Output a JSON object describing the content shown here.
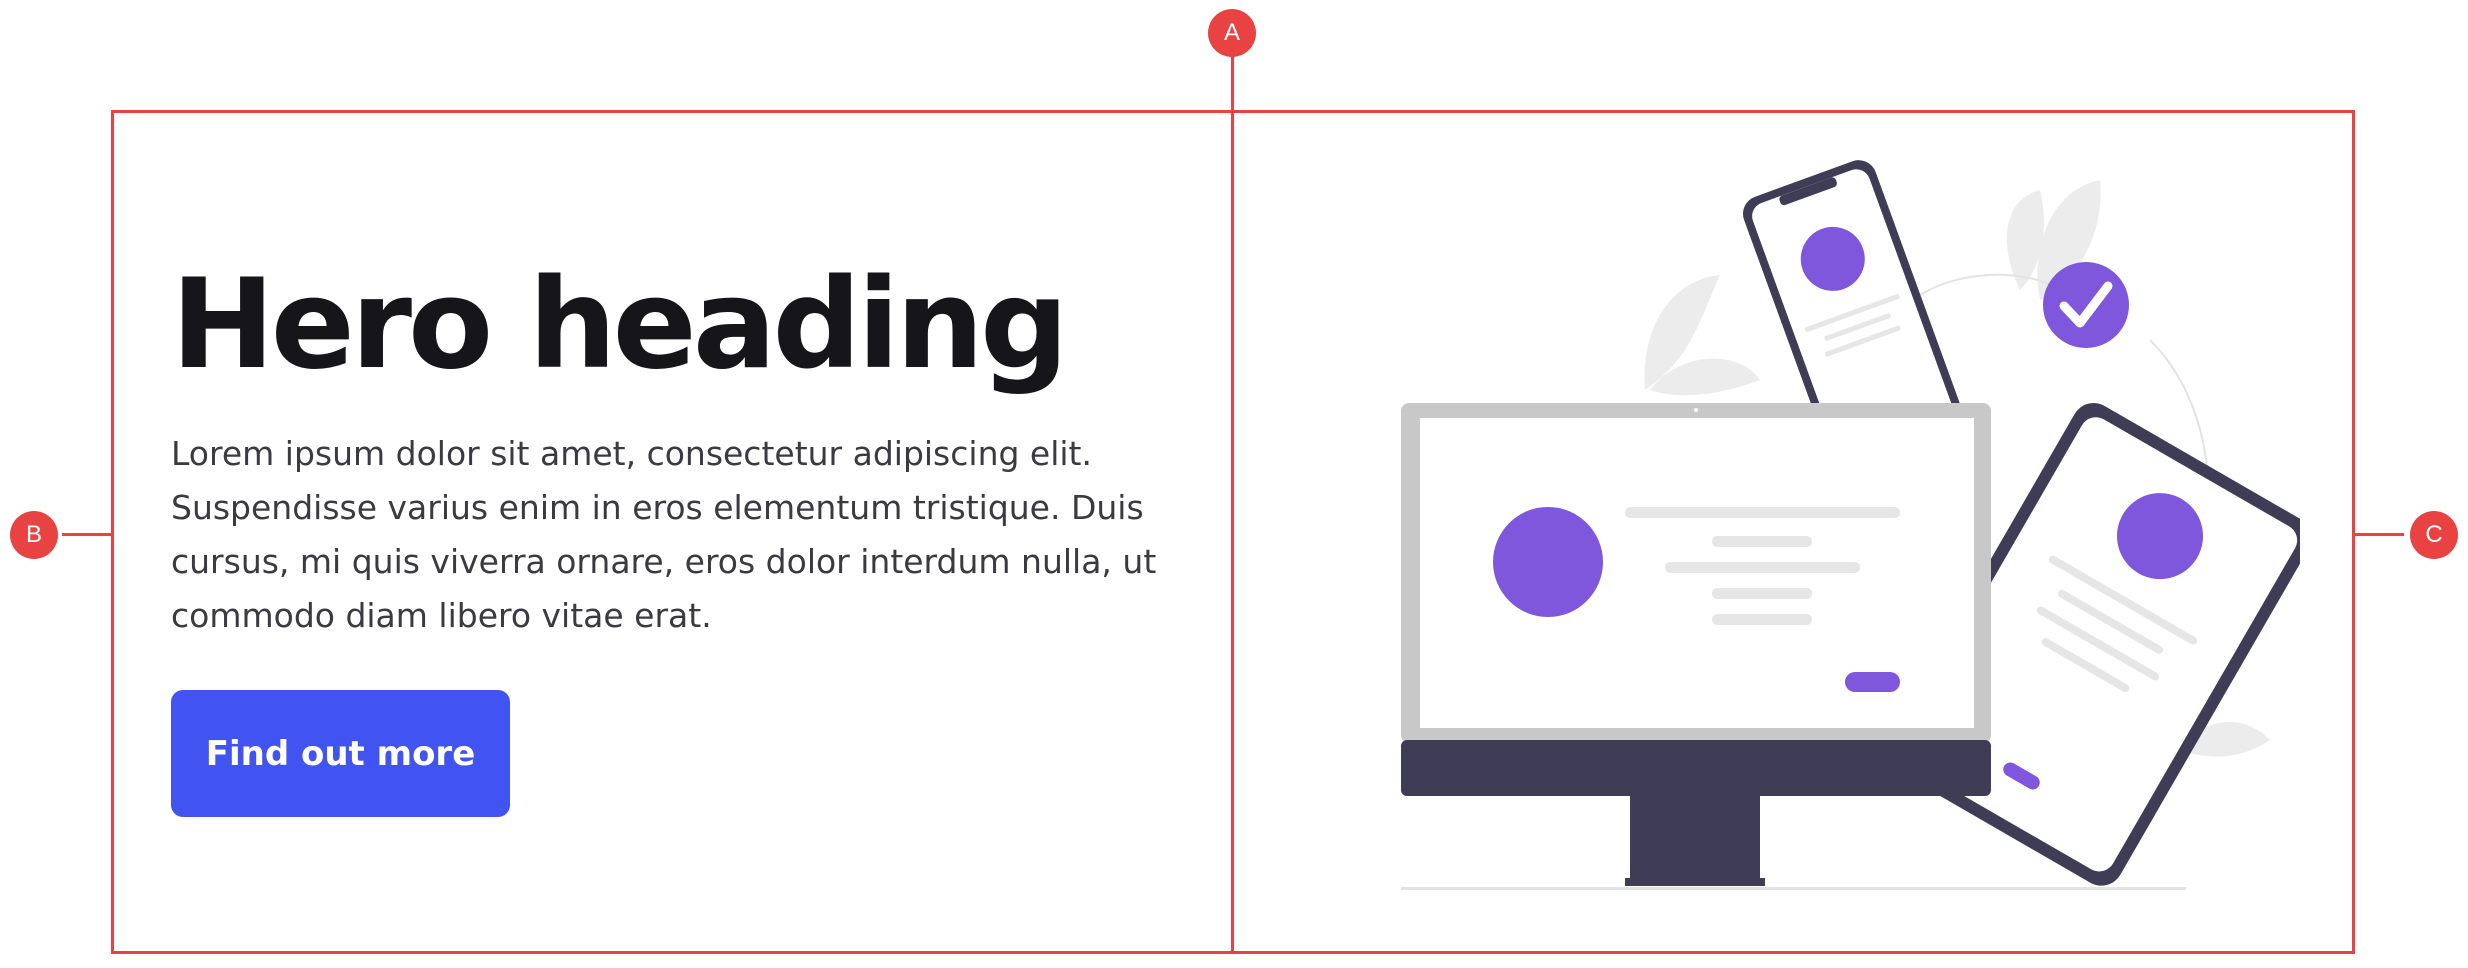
{
  "annotations": {
    "marker_a": "A",
    "marker_b": "B",
    "marker_c": "C"
  },
  "hero": {
    "heading": "Hero heading",
    "body": "Lorem ipsum dolor sit amet, consectetur adipiscing elit. Suspendisse varius enim in eros elementum tristique. Duis cursus, mi quis viverra ornare, eros dolor interdum nulla, ut commodo diam libero vitae erat.",
    "cta_label": "Find out more"
  },
  "colors": {
    "annotation": "#e84242",
    "button": "#4154f1",
    "accent_purple": "#7e57dd",
    "device_dark": "#3f3d56",
    "heading": "#16161a"
  },
  "illustration": {
    "icons": [
      "desktop-monitor-icon",
      "smartphone-icon",
      "tablet-icon",
      "checkmark-badge-icon",
      "leaf-icon"
    ]
  }
}
